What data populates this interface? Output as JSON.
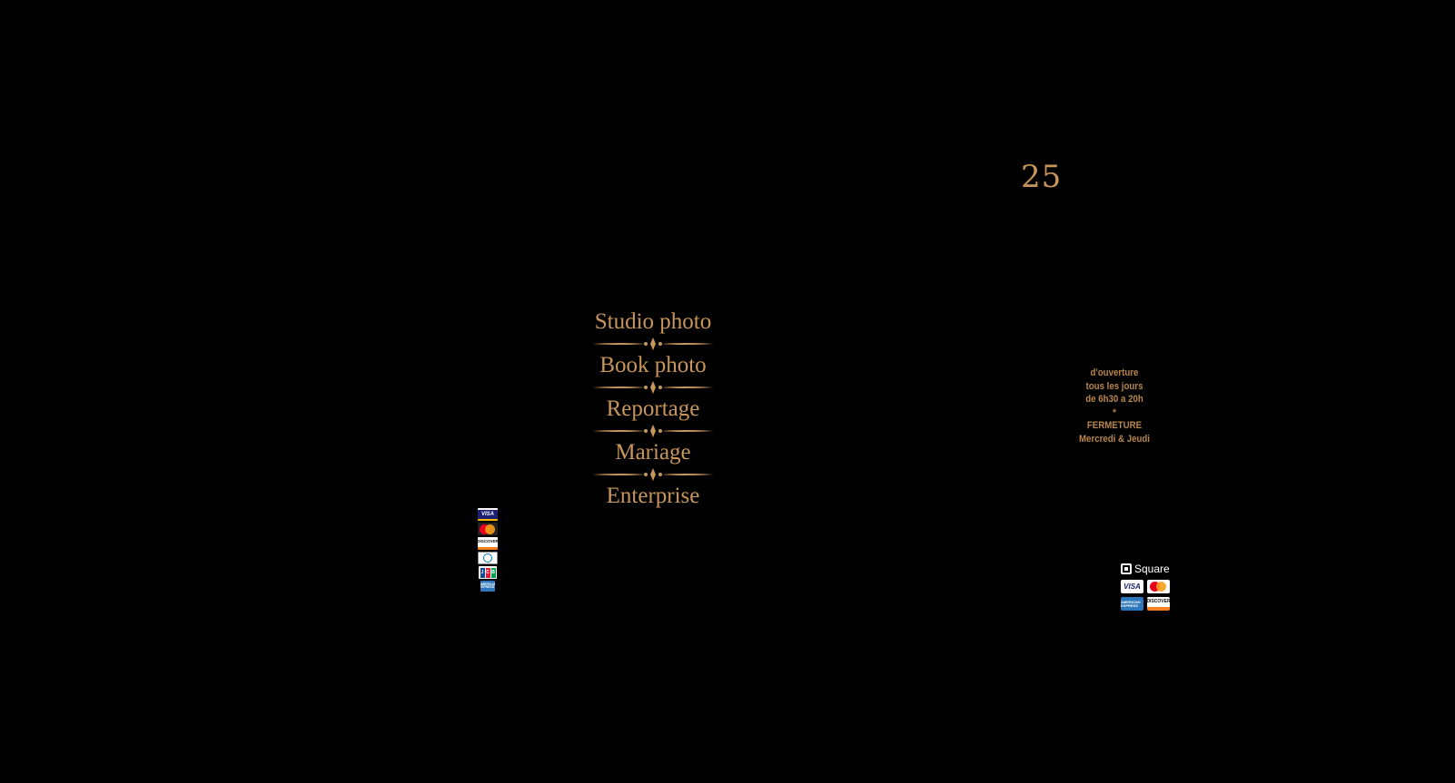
{
  "header": {
    "number": "25"
  },
  "menu": {
    "items": [
      {
        "label": "Studio photo"
      },
      {
        "label": "Book photo"
      },
      {
        "label": "Reportage"
      },
      {
        "label": "Mariage"
      },
      {
        "label": "Enterprise"
      }
    ]
  },
  "hours": {
    "line1": "d'ouverture",
    "line2": "tous les jours",
    "line3": "de 6h30 a 20h",
    "separator": "*",
    "line4": "FERMETURE",
    "line5": "Mercredi & Jeudi"
  },
  "payments_left": {
    "visa": "VISA",
    "discover": "DISCOVER",
    "jcb": "JCB",
    "amex": "AMERICAN EXPRESS"
  },
  "square": {
    "label": "Square",
    "visa": "VISA",
    "amex": "AMERICAN EXPRESS",
    "discover": "DISCOVER"
  },
  "colors": {
    "background": "#000000",
    "gold": "#c8965a",
    "gold_dark": "#b8864a"
  }
}
